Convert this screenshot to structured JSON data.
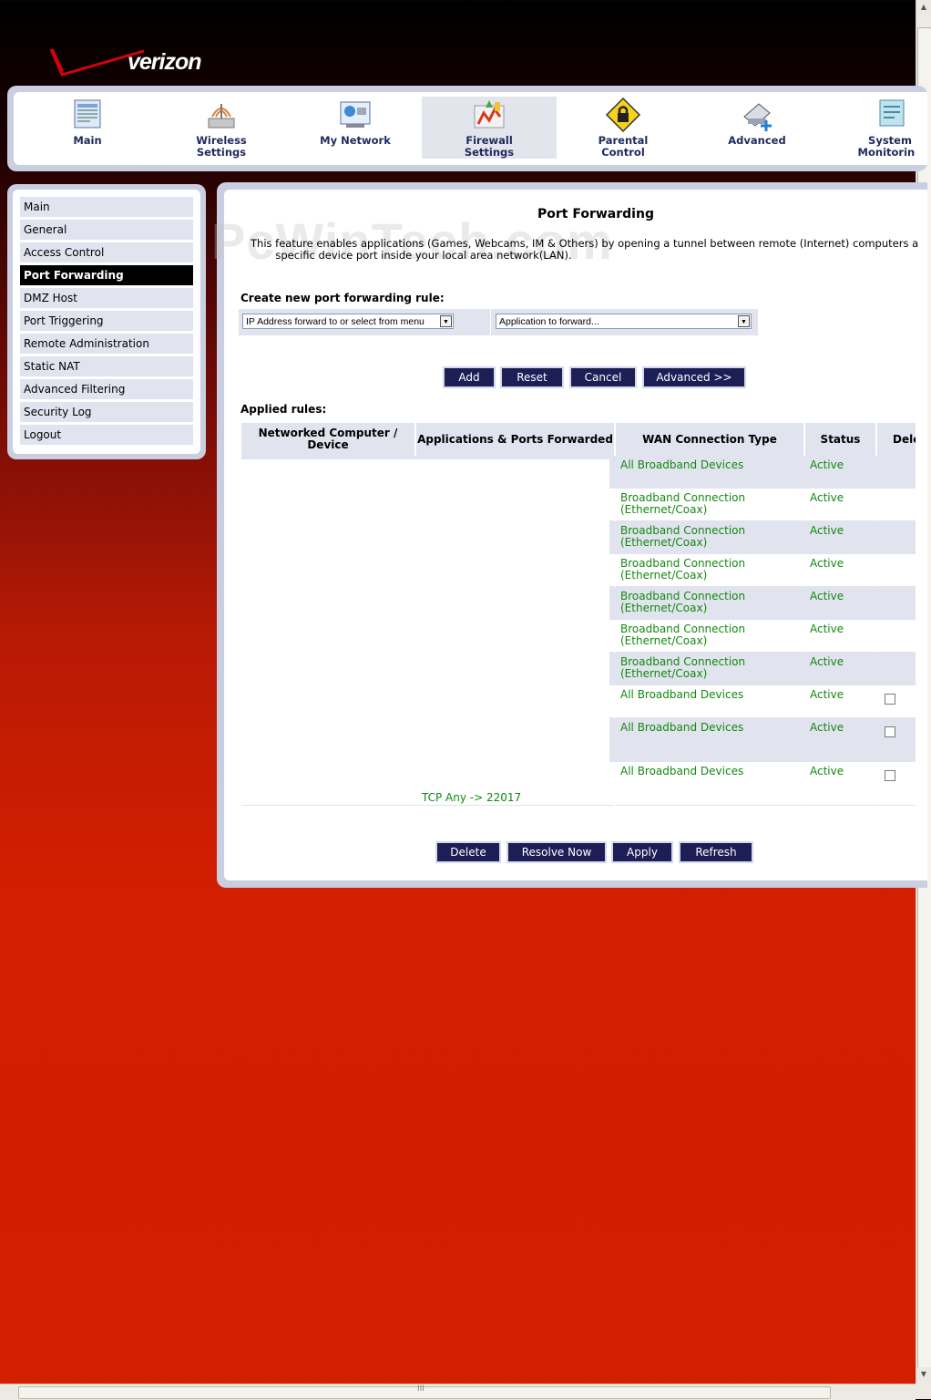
{
  "brand": {
    "name": "verizon"
  },
  "topnav": {
    "items": [
      {
        "label": "Main",
        "icon": "main-icon"
      },
      {
        "label": "Wireless Settings",
        "icon": "wireless-icon"
      },
      {
        "label": "My Network",
        "icon": "network-icon"
      },
      {
        "label": "Firewall Settings",
        "icon": "firewall-icon",
        "active": true
      },
      {
        "label": "Parental Control",
        "icon": "parental-lock-icon"
      },
      {
        "label": "Advanced",
        "icon": "advanced-icon"
      },
      {
        "label": "System Monitoring",
        "icon": "monitor-icon"
      }
    ]
  },
  "sidebar": {
    "items": [
      {
        "label": "Main"
      },
      {
        "label": "General"
      },
      {
        "label": "Access Control"
      },
      {
        "label": "Port Forwarding",
        "active": true
      },
      {
        "label": "DMZ Host"
      },
      {
        "label": "Port Triggering"
      },
      {
        "label": "Remote Administration"
      },
      {
        "label": "Static NAT"
      },
      {
        "label": "Advanced Filtering"
      },
      {
        "label": "Security Log"
      },
      {
        "label": "Logout"
      }
    ]
  },
  "page": {
    "title": "Port Forwarding",
    "watermark": "PcWinTech.com",
    "description_line1": "This feature enables applications (Games, Webcams, IM & Others) by opening a tunnel between remote (Internet) computers a",
    "description_line2": "specific device port inside your local area network(LAN)."
  },
  "create_rule": {
    "label": "Create new port forwarding rule:",
    "ip_select": "IP Address forward to or select from menu",
    "app_select": "Application to forward...",
    "buttons": {
      "add": "Add",
      "reset": "Reset",
      "cancel": "Cancel",
      "advanced": "Advanced >>"
    }
  },
  "applied": {
    "label": "Applied rules:",
    "headers": {
      "device": "Networked Computer / Device",
      "apps": "Applications & Ports Forwarded",
      "wan": "WAN Connection Type",
      "status": "Status",
      "delete": "Delete"
    },
    "rows": [
      {
        "wan1": "All Broadband Devices",
        "wan2": "",
        "status": "Active",
        "checkbox": false
      },
      {
        "wan1": "Broadband Connection",
        "wan2": "(Ethernet/Coax)",
        "status": "Active",
        "checkbox": false
      },
      {
        "wan1": "Broadband Connection",
        "wan2": "(Ethernet/Coax)",
        "status": "Active",
        "checkbox": false
      },
      {
        "wan1": "Broadband Connection",
        "wan2": "(Ethernet/Coax)",
        "status": "Active",
        "checkbox": false
      },
      {
        "wan1": "Broadband Connection",
        "wan2": "(Ethernet/Coax)",
        "status": "Active",
        "checkbox": false
      },
      {
        "wan1": "Broadband Connection",
        "wan2": "(Ethernet/Coax)",
        "status": "Active",
        "checkbox": false
      },
      {
        "wan1": "Broadband Connection",
        "wan2": "(Ethernet/Coax)",
        "status": "Active",
        "checkbox": false
      },
      {
        "wan1": "All Broadband Devices",
        "wan2": "",
        "status": "Active",
        "checkbox": true
      },
      {
        "wan1": "All Broadband Devices",
        "wan2": "",
        "status": "Active",
        "checkbox": true
      },
      {
        "wan1": "All Broadband Devices",
        "wan2": "",
        "status": "Active",
        "checkbox": true
      }
    ],
    "last_app_text": "TCP Any -> 22017"
  },
  "bottom_buttons": {
    "delete": "Delete",
    "resolve": "Resolve Now",
    "apply": "Apply",
    "refresh": "Refresh"
  }
}
